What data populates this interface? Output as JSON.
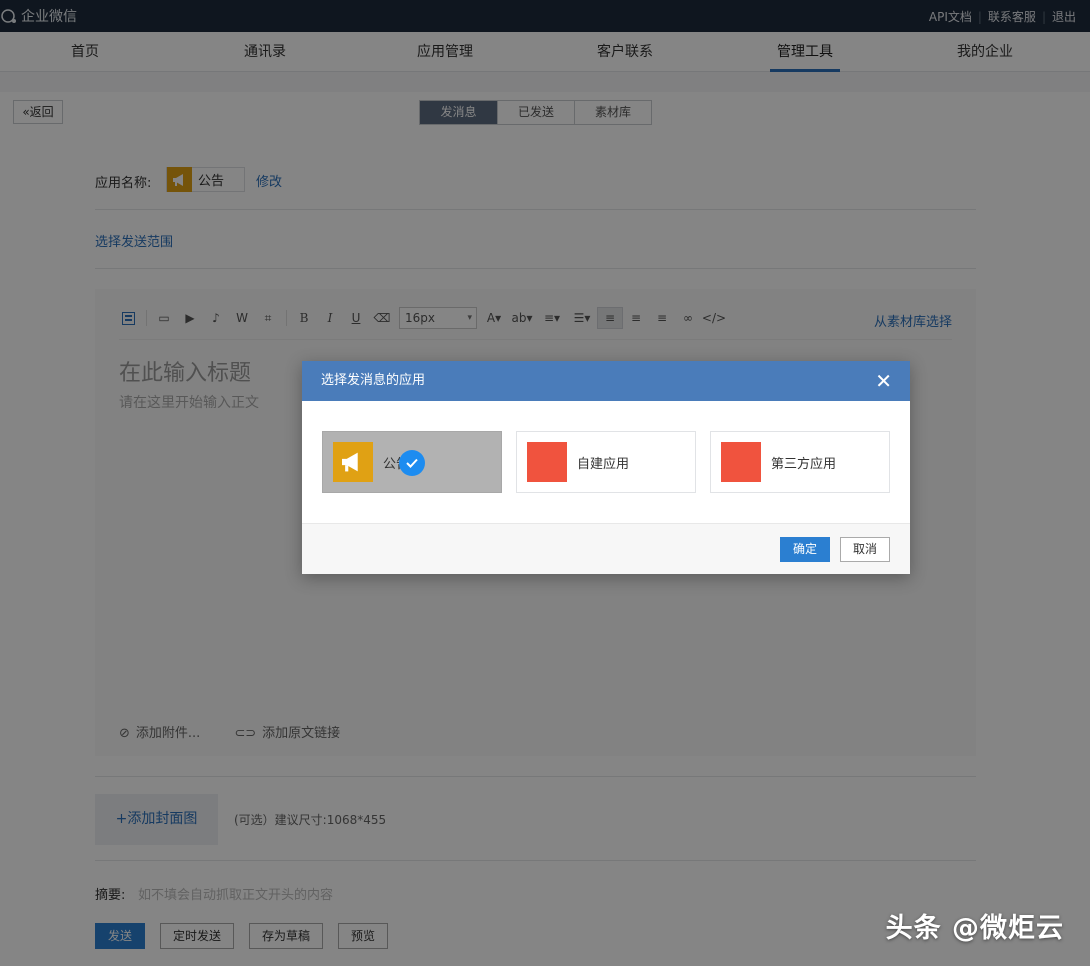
{
  "topbar": {
    "brand": "企业微信",
    "links": [
      "API文档",
      "联系客服",
      "退出"
    ]
  },
  "nav": {
    "items": [
      "首页",
      "通讯录",
      "应用管理",
      "客户联系",
      "管理工具",
      "我的企业"
    ],
    "active": "管理工具"
  },
  "page": {
    "back_label": "返回",
    "tabs": [
      "发消息",
      "已发送",
      "素材库"
    ],
    "active_tab": "发消息"
  },
  "form": {
    "app_name_label": "应用名称:",
    "app_name_value": "公告",
    "edit_link": "修改",
    "select_range": "选择发送范围",
    "font_size": "16px",
    "material_link": "从素材库选择",
    "title_placeholder": "在此输入标题",
    "body_placeholder": "请在这里开始输入正文",
    "attach_label": "添加附件...",
    "link_label": "添加原文链接",
    "cover_label": "+添加封面图",
    "cover_hint": "(可选）建议尺寸:1068*455",
    "summary_label": "摘要:",
    "summary_placeholder": "如不填会自动抓取正文开头的内容"
  },
  "actions": {
    "send": "发送",
    "schedule": "定时发送",
    "draft": "存为草稿",
    "preview": "预览"
  },
  "modal": {
    "title": "选择发消息的应用",
    "apps": [
      {
        "label": "公告",
        "selected": true,
        "icon": "megaphone-icon",
        "color": "#e0a114"
      },
      {
        "label": "自建应用",
        "selected": false,
        "icon": "app-icon",
        "color": "#f0533e"
      },
      {
        "label": "第三方应用",
        "selected": false,
        "icon": "app-icon",
        "color": "#f0533e"
      }
    ],
    "confirm": "确定",
    "cancel": "取消"
  },
  "watermark": "头条 @微炬云",
  "colors": {
    "accent": "#2b7fd1",
    "modal_header": "#4a7cba",
    "topbar": "#1e2b3c"
  }
}
